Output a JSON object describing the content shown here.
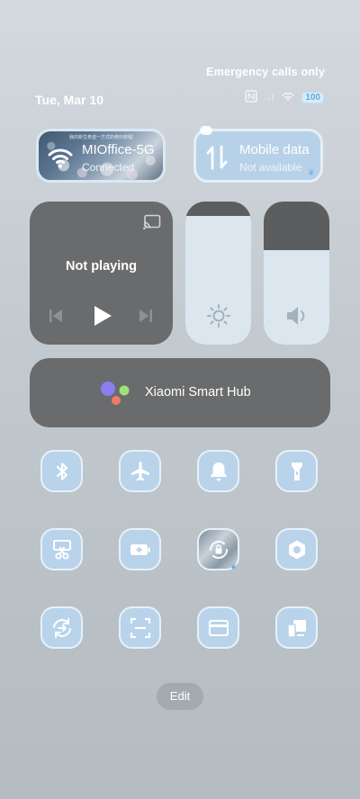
{
  "status_bar": {
    "emergency_text": "Emergency calls only",
    "date": "Tue, Mar 10",
    "battery": "100"
  },
  "wifi_tile": {
    "title": "MIOffice-5G",
    "status": "Connected",
    "tiny_text": "我的新生奇迹一方式的奇妙旅程!"
  },
  "mobile_data_tile": {
    "title": "Mobile data",
    "status": "Not available"
  },
  "media": {
    "status": "Not playing"
  },
  "sliders": {
    "brightness_level": 0.9,
    "volume_level": 0.66
  },
  "smart_hub": {
    "label": "Xiaomi Smart Hub"
  },
  "toggles": [
    {
      "name": "bluetooth",
      "icon": "bluetooth-icon"
    },
    {
      "name": "airplane-mode",
      "icon": "airplane-icon"
    },
    {
      "name": "ringer",
      "icon": "bell-icon"
    },
    {
      "name": "flashlight",
      "icon": "flashlight-icon"
    },
    {
      "name": "screenshot",
      "icon": "scissors-icon"
    },
    {
      "name": "battery-saver",
      "icon": "battery-plus-icon"
    },
    {
      "name": "rotation-lock",
      "icon": "lock-rotate-icon"
    },
    {
      "name": "settings",
      "icon": "gear-hex-icon"
    },
    {
      "name": "data-saver",
      "icon": "sync-icon"
    },
    {
      "name": "scanner",
      "icon": "scan-icon"
    },
    {
      "name": "wallet",
      "icon": "card-icon"
    },
    {
      "name": "device-connect",
      "icon": "devices-icon"
    }
  ],
  "colors": {
    "tile_blue": "#b8d3ea",
    "tile_dark": "#6a6b6c",
    "slider_fill": "#dbe6ee"
  },
  "footer": {
    "edit_label": "Edit"
  }
}
